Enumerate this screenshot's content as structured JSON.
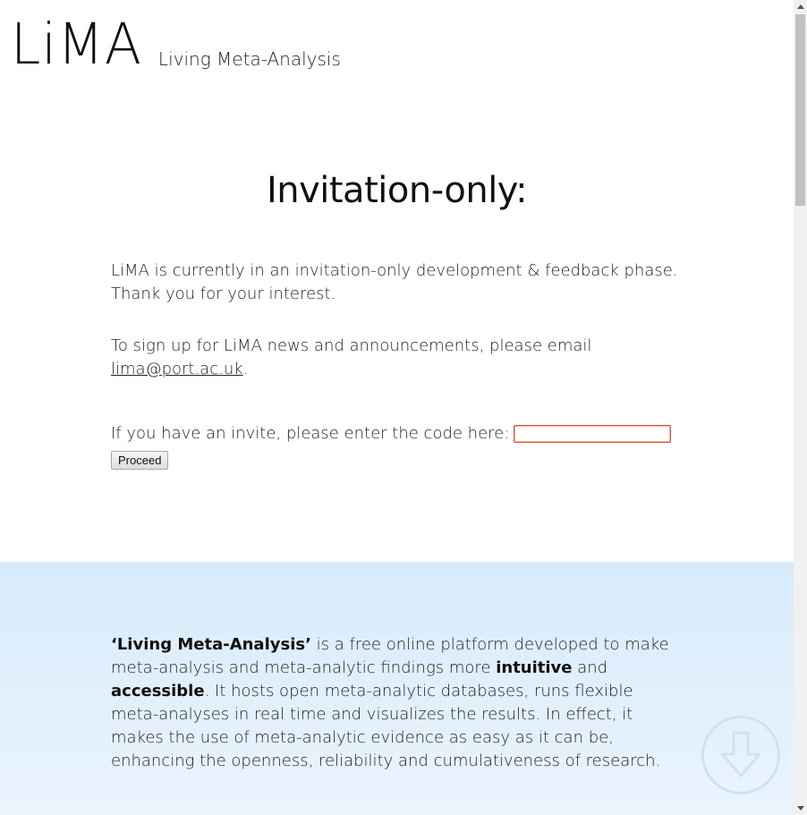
{
  "header": {
    "logo": "LiMA",
    "tagline": "Living Meta-Analysis"
  },
  "main": {
    "title": "Invitation-only:",
    "intro_line1": "LiMA is currently in an invitation-only development & feedback phase.",
    "intro_line2": "Thank you for your interest.",
    "signup_text": "To sign up for LiMA news and announcements, please email",
    "email": "lima@port.ac.uk",
    "email_suffix": ".",
    "invite_label": "If you have an invite, please enter the code here:",
    "invite_value": "",
    "proceed_label": "Proceed"
  },
  "about": {
    "term": "‘Living Meta-Analysis’",
    "text1": " is a free online platform developed to make meta-analysis and meta-analytic findings more ",
    "bold1": "intuitive",
    "text2": " and ",
    "bold2": "accessible",
    "text3": ". It hosts open meta-analytic databases, runs flexible meta-analyses in real time and visualizes the results. In effect, it makes the use of meta-analytic evidence as easy as it can be, enhancing the openness, reliability and cumulativeness of research."
  },
  "icons": {
    "scroll_down": "arrow-down-circle-icon"
  },
  "colors": {
    "about_background": "#d7ebfb",
    "input_border": "#d9543a"
  }
}
